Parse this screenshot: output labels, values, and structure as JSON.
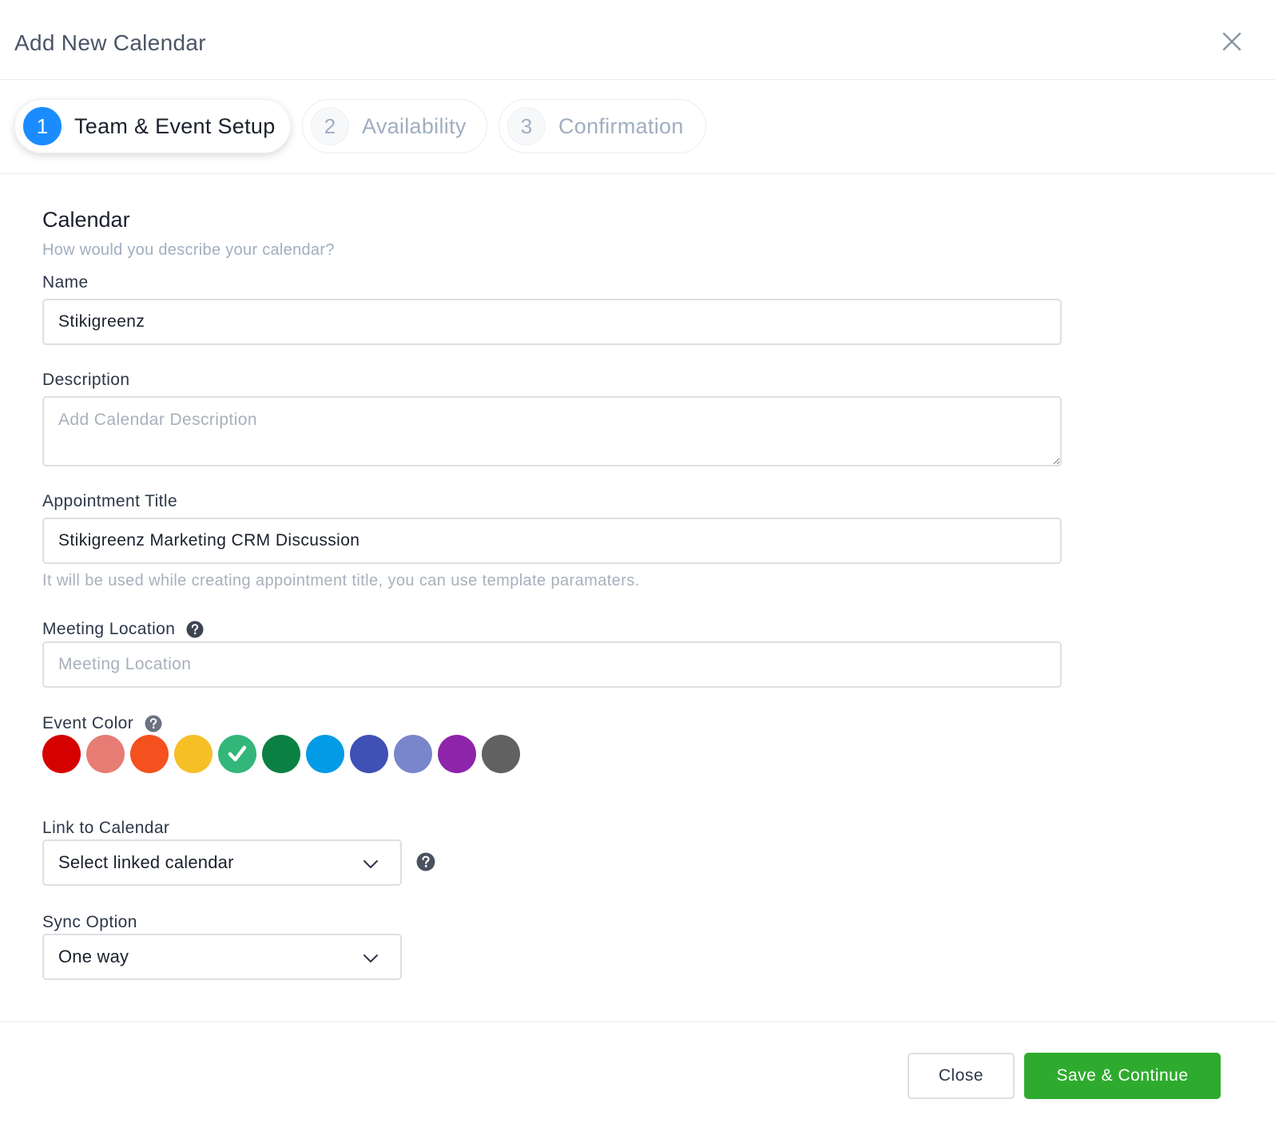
{
  "modal": {
    "title": "Add New Calendar"
  },
  "steps": [
    {
      "num": "1",
      "label": "Team & Event Setup",
      "active": true
    },
    {
      "num": "2",
      "label": "Availability",
      "active": false
    },
    {
      "num": "3",
      "label": "Confirmation",
      "active": false
    }
  ],
  "form": {
    "section_title": "Calendar",
    "section_subtitle": "How would you describe your calendar?",
    "name": {
      "label": "Name",
      "value": "Stikigreenz"
    },
    "description": {
      "label": "Description",
      "value": "",
      "placeholder": "Add Calendar Description"
    },
    "appointment_title": {
      "label": "Appointment Title",
      "value": "Stikigreenz Marketing CRM Discussion",
      "hint": "It will be used while creating appointment title, you can use template paramaters."
    },
    "meeting_location": {
      "label": "Meeting Location",
      "value": "",
      "placeholder": "Meeting Location"
    },
    "event_color": {
      "label": "Event Color",
      "selected_index": 4,
      "colors": [
        "#d50000",
        "#e67c73",
        "#f4511e",
        "#f6bf26",
        "#33b679",
        "#0b8043",
        "#039be5",
        "#3f51b5",
        "#7986cb",
        "#8e24aa",
        "#616161"
      ]
    },
    "link_to_calendar": {
      "label": "Link to Calendar",
      "selected": "Select linked calendar"
    },
    "sync_option": {
      "label": "Sync Option",
      "selected": "One way"
    }
  },
  "footer": {
    "close_label": "Close",
    "save_label": "Save & Continue"
  },
  "colors": {
    "accent": "#1a8cff",
    "primary_button": "#2eab2e"
  }
}
